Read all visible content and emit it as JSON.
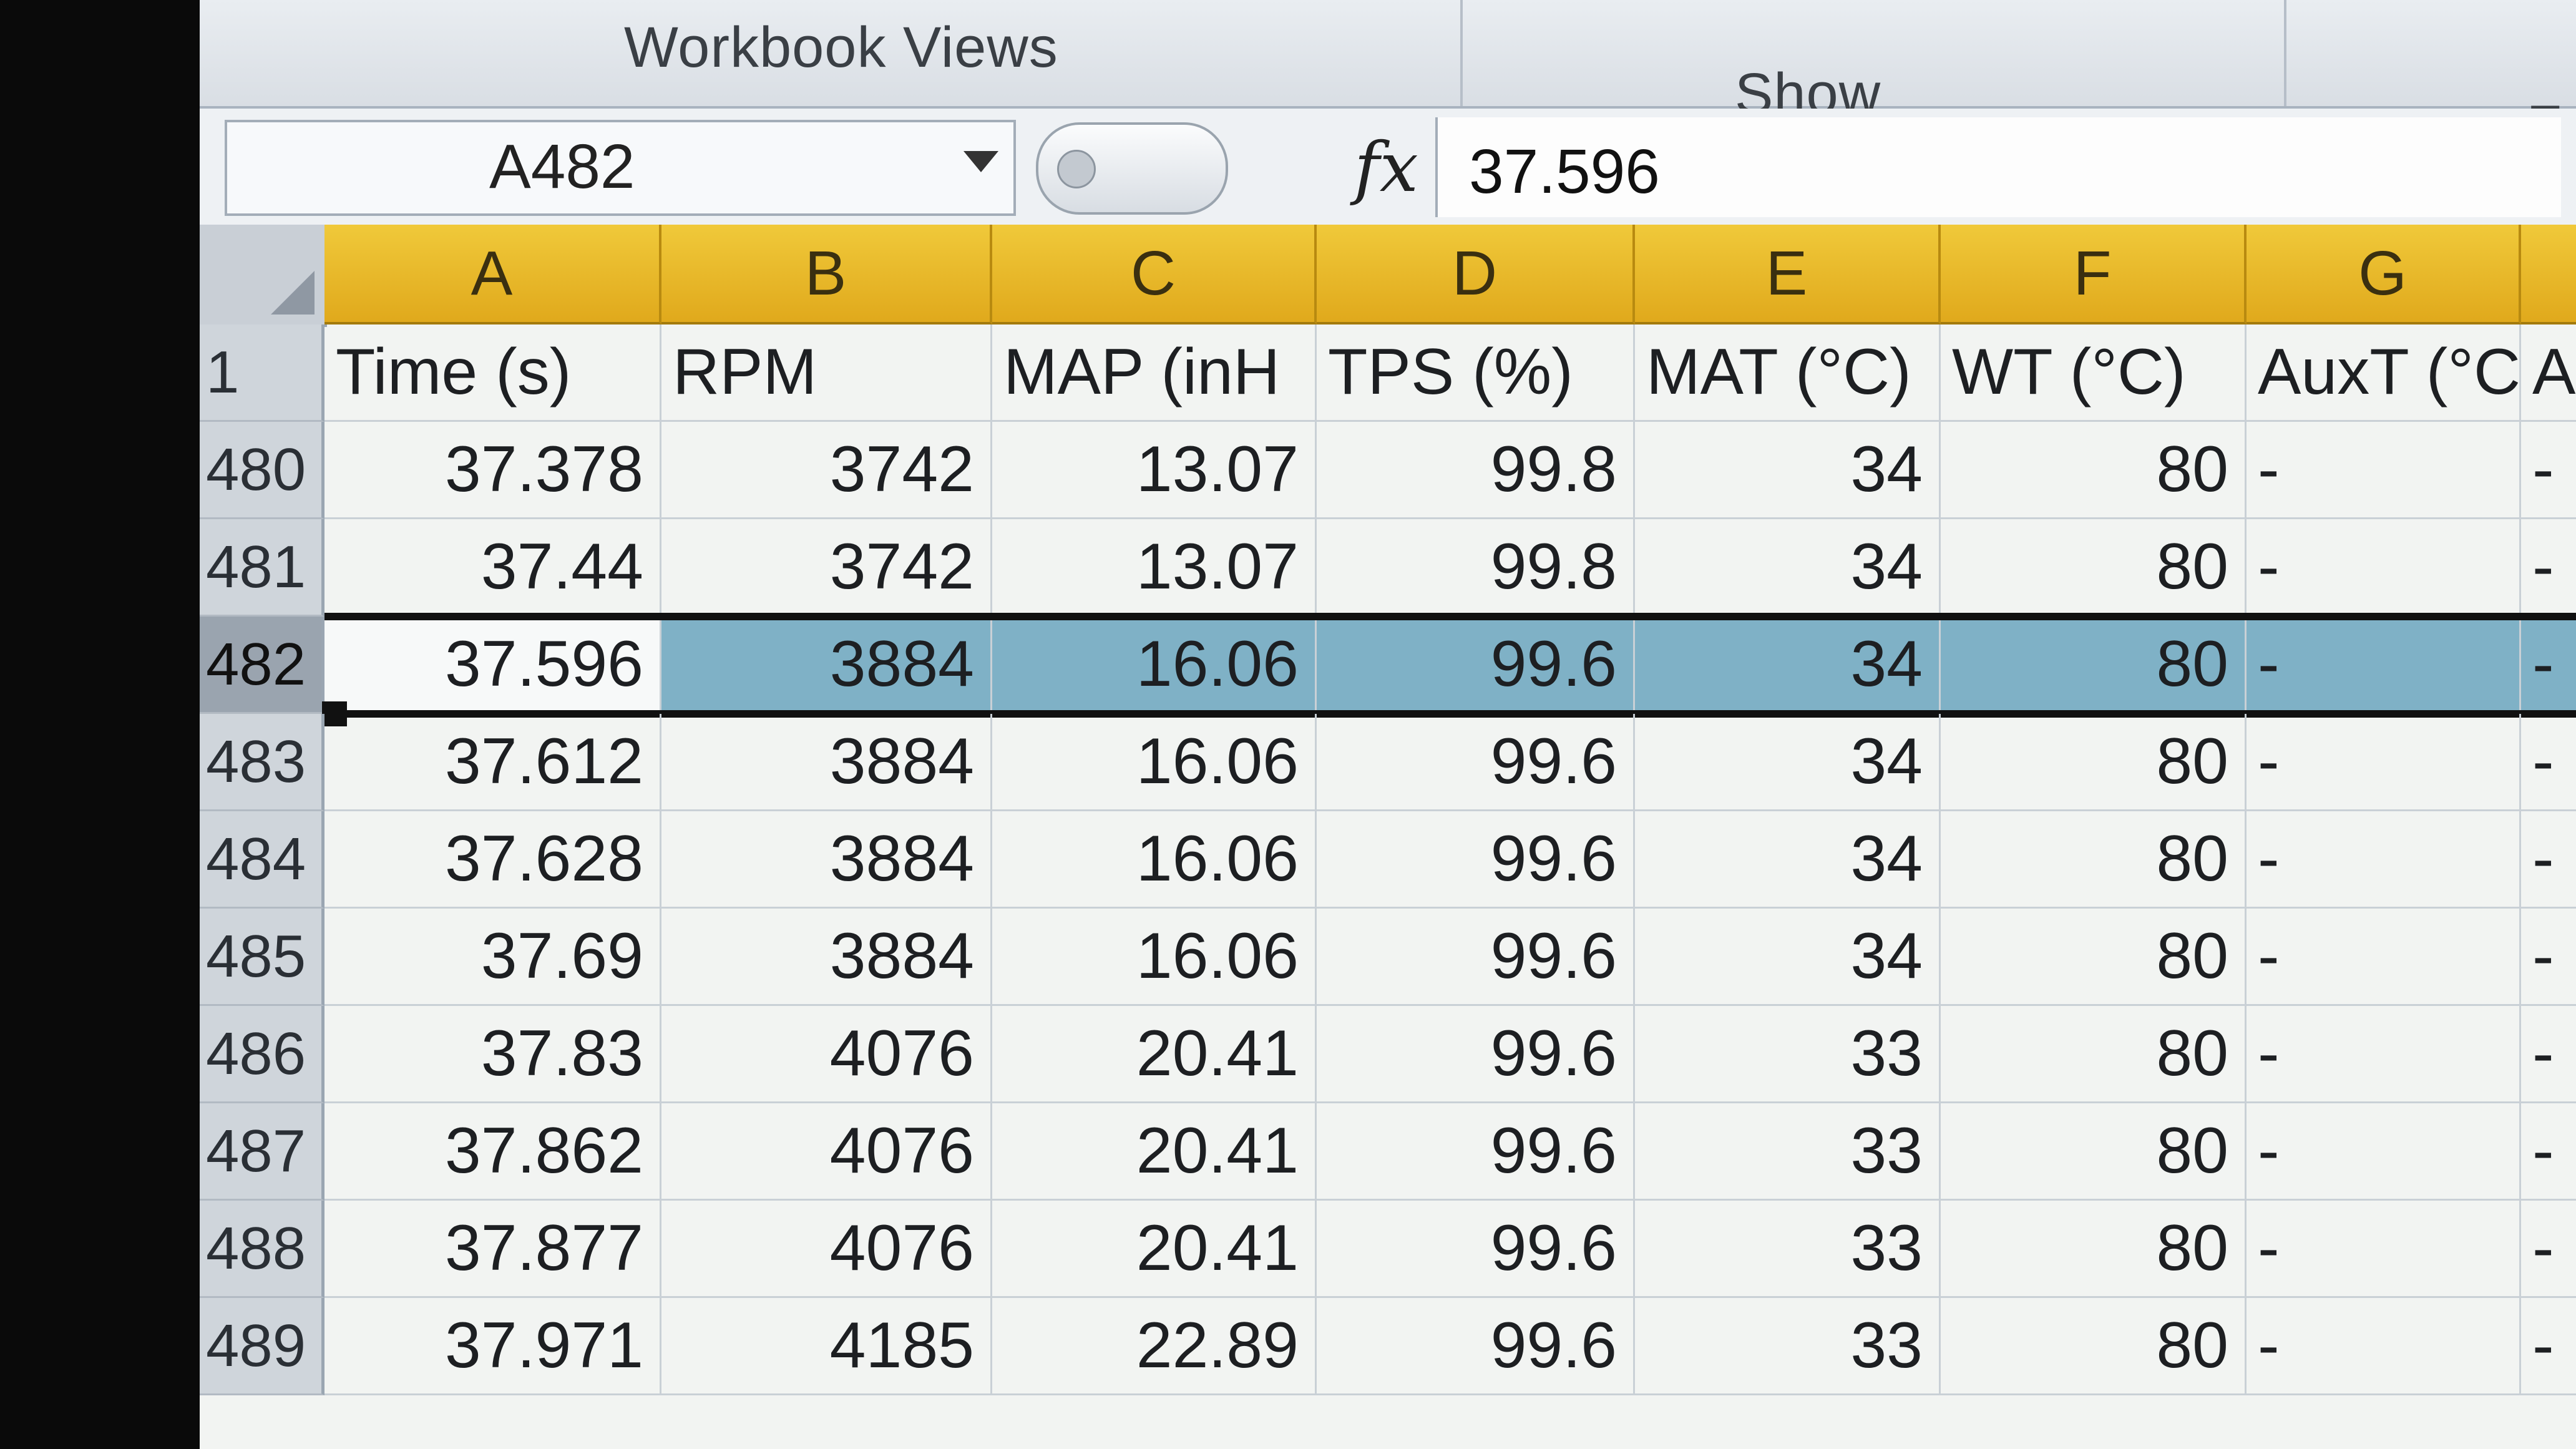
{
  "ribbon": {
    "groups": [
      {
        "label": "Workbook Views"
      },
      {
        "label": "Show"
      },
      {
        "label": "Zo"
      }
    ]
  },
  "formula_bar": {
    "name_box": "A482",
    "fx_symbol": "fx",
    "formula_value": "37.596"
  },
  "columns": [
    "A",
    "B",
    "C",
    "D",
    "E",
    "F",
    "G"
  ],
  "header_row": {
    "row_number": "1",
    "cells": [
      "Time (s)",
      "RPM",
      "MAP (inH",
      "TPS (%)",
      "MAT (°C)",
      "WT (°C)",
      "AuxT (°C)",
      "A"
    ]
  },
  "rows": [
    {
      "num": "480",
      "cells": [
        "37.378",
        "3742",
        "13.07",
        "99.8",
        "34",
        "80",
        "-",
        "-"
      ]
    },
    {
      "num": "481",
      "cells": [
        "37.44",
        "3742",
        "13.07",
        "99.8",
        "34",
        "80",
        "-",
        "-"
      ]
    },
    {
      "num": "482",
      "cells": [
        "37.596",
        "3884",
        "16.06",
        "99.6",
        "34",
        "80",
        "-",
        "-"
      ]
    },
    {
      "num": "483",
      "cells": [
        "37.612",
        "3884",
        "16.06",
        "99.6",
        "34",
        "80",
        "-",
        "-"
      ]
    },
    {
      "num": "484",
      "cells": [
        "37.628",
        "3884",
        "16.06",
        "99.6",
        "34",
        "80",
        "-",
        "-"
      ]
    },
    {
      "num": "485",
      "cells": [
        "37.69",
        "3884",
        "16.06",
        "99.6",
        "34",
        "80",
        "-",
        "-"
      ]
    },
    {
      "num": "486",
      "cells": [
        "37.83",
        "4076",
        "20.41",
        "99.6",
        "33",
        "80",
        "-",
        "-"
      ]
    },
    {
      "num": "487",
      "cells": [
        "37.862",
        "4076",
        "20.41",
        "99.6",
        "33",
        "80",
        "-",
        "-"
      ]
    },
    {
      "num": "488",
      "cells": [
        "37.877",
        "4076",
        "20.41",
        "99.6",
        "33",
        "80",
        "-",
        "-"
      ]
    },
    {
      "num": "489",
      "cells": [
        "37.971",
        "4185",
        "22.89",
        "99.6",
        "33",
        "80",
        "-",
        "-"
      ]
    }
  ],
  "selection": {
    "row": "482",
    "active_cell": "A482"
  },
  "colors": {
    "column_header": "#e6b42a",
    "selection": "#7fb1c6"
  }
}
